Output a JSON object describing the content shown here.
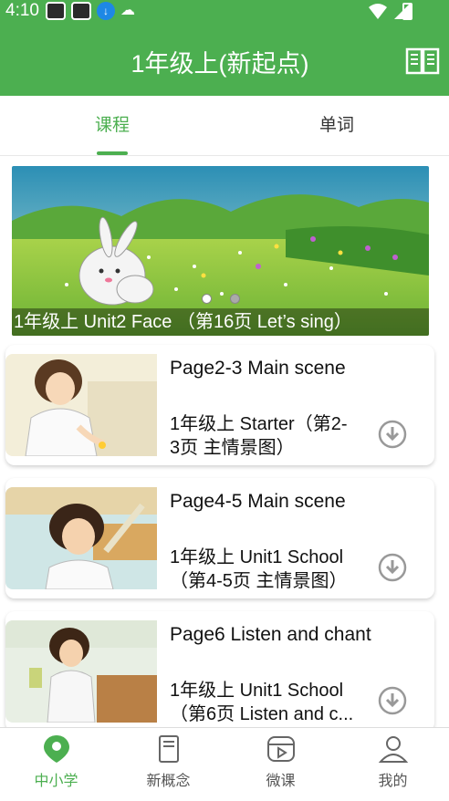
{
  "status": {
    "time": "4:10"
  },
  "header": {
    "title": "1年级上(新起点)"
  },
  "tabs": [
    {
      "label": "课程",
      "active": true
    },
    {
      "label": "单词",
      "active": false
    }
  ],
  "banner": {
    "caption": "1年级上 Unit2 Face （第16页 Let’s sing）",
    "dots_total": 2,
    "dot_active": 0
  },
  "lessons": [
    {
      "title": "Page2-3 Main scene",
      "subtitle": "1年级上 Starter（第2-3页 主情景图）"
    },
    {
      "title": "Page4-5 Main scene",
      "subtitle": "1年级上 Unit1 School（第4-5页 主情景图）"
    },
    {
      "title": "Page6 Listen and chant",
      "subtitle": "1年级上 Unit1 School（第6页 Listen and c..."
    }
  ],
  "nav": [
    {
      "label": "中小学",
      "active": true
    },
    {
      "label": "新概念",
      "active": false
    },
    {
      "label": "微课",
      "active": false
    },
    {
      "label": "我的",
      "active": false
    }
  ],
  "colors": {
    "accent": "#4caf50",
    "header_bg": "#4caf50"
  }
}
